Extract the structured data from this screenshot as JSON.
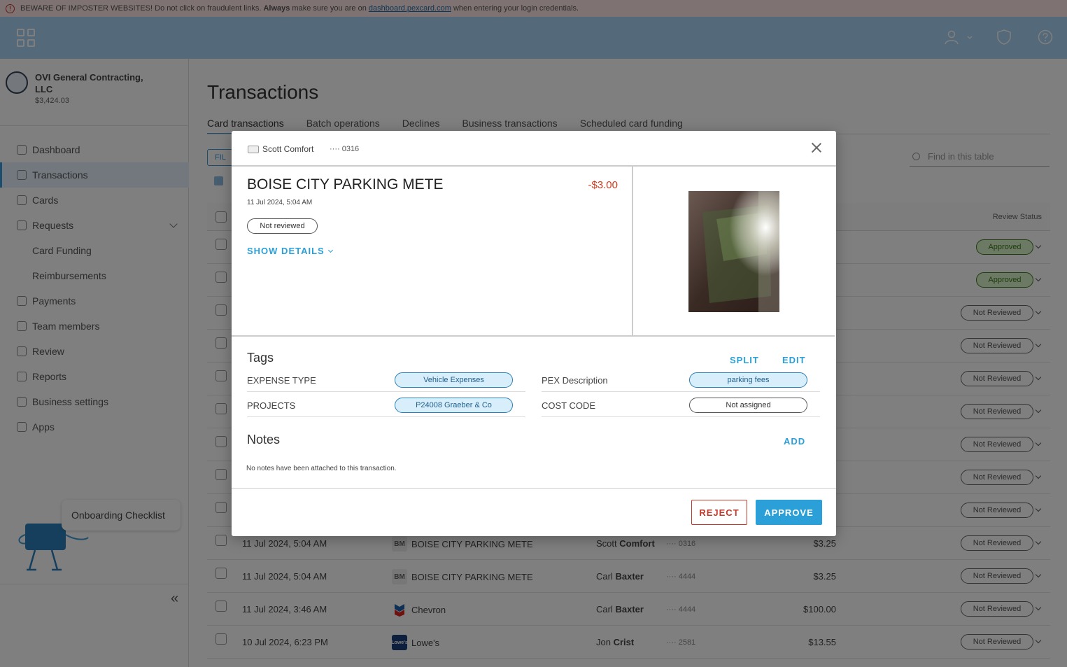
{
  "banner": {
    "lead": "BEWARE OF IMPOSTER WEBSITES!",
    "text1": "Do not click on fraudulent links.",
    "bold": "Always",
    "text2": "make sure you are on",
    "link": "dashboard.pexcard.com",
    "text3": "when entering your login credentials."
  },
  "org": {
    "name": "OVI General Contracting, LLC",
    "balance": "$3,424.03"
  },
  "nav": [
    {
      "label": "Dashboard",
      "icon": "dashboard-icon"
    },
    {
      "label": "Transactions",
      "icon": "transactions-icon"
    },
    {
      "label": "Cards",
      "icon": "cards-icon"
    },
    {
      "label": "Requests",
      "icon": "requests-icon"
    },
    {
      "label": "Card Funding",
      "icon": ""
    },
    {
      "label": "Reimbursements",
      "icon": ""
    },
    {
      "label": "Payments",
      "icon": "payments-icon"
    },
    {
      "label": "Team members",
      "icon": "team-icon"
    },
    {
      "label": "Review",
      "icon": "review-icon"
    },
    {
      "label": "Reports",
      "icon": "reports-icon"
    },
    {
      "label": "Business settings",
      "icon": "settings-icon"
    },
    {
      "label": "Apps",
      "icon": "apps-icon"
    }
  ],
  "onboarding": "Onboarding Checklist",
  "page": {
    "title": "Transactions",
    "tabs": [
      "Card transactions",
      "Batch operations",
      "Declines",
      "Business transactions",
      "Scheduled card funding"
    ],
    "filter_label": "FIL",
    "search_placeholder": "Find in this table",
    "review_status_header": "Review Status"
  },
  "rows": [
    {
      "date": "",
      "merchant": "",
      "logo": "",
      "user_first": "",
      "user_last": "",
      "card": "",
      "amount": "",
      "status": "Approved"
    },
    {
      "date": "",
      "merchant": "",
      "logo": "",
      "user_first": "",
      "user_last": "",
      "card": "",
      "amount": "",
      "status": "Approved"
    },
    {
      "date": "",
      "merchant": "",
      "logo": "",
      "user_first": "",
      "user_last": "",
      "card": "",
      "amount": "",
      "status": "Not Reviewed"
    },
    {
      "date": "",
      "merchant": "",
      "logo": "",
      "user_first": "",
      "user_last": "",
      "card": "",
      "amount": "",
      "status": "Not Reviewed"
    },
    {
      "date": "",
      "merchant": "",
      "logo": "",
      "user_first": "",
      "user_last": "",
      "card": "",
      "amount": "",
      "status": "Not Reviewed"
    },
    {
      "date": "",
      "merchant": "",
      "logo": "",
      "user_first": "",
      "user_last": "",
      "card": "",
      "amount": "",
      "status": "Not Reviewed"
    },
    {
      "date": "",
      "merchant": "",
      "logo": "",
      "user_first": "",
      "user_last": "",
      "card": "",
      "amount": "",
      "status": "Not Reviewed"
    },
    {
      "date": "",
      "merchant": "",
      "logo": "",
      "user_first": "",
      "user_last": "",
      "card": "",
      "amount": "",
      "status": "Not Reviewed"
    },
    {
      "date": "",
      "merchant": "",
      "logo": "",
      "user_first": "",
      "user_last": "",
      "card": "",
      "amount": "",
      "status": "Not Reviewed"
    },
    {
      "date": "11 Jul 2024, 5:04 AM",
      "merchant": "BOISE CITY PARKING METE",
      "logo": "BM",
      "user_first": "Scott",
      "user_last": "Comfort",
      "card": "···· 0316",
      "amount": "$3.25",
      "status": "Not Reviewed"
    },
    {
      "date": "11 Jul 2024, 5:04 AM",
      "merchant": "BOISE CITY PARKING METE",
      "logo": "BM",
      "user_first": "Carl",
      "user_last": "Baxter",
      "card": "···· 4444",
      "amount": "$3.25",
      "status": "Not Reviewed"
    },
    {
      "date": "11 Jul 2024, 3:46 AM",
      "merchant": "Chevron",
      "logo": "",
      "user_first": "Carl",
      "user_last": "Baxter",
      "card": "···· 4444",
      "amount": "$100.00",
      "status": "Not Reviewed"
    },
    {
      "date": "10 Jul 2024, 6:23 PM",
      "merchant": "Lowe's",
      "logo": "",
      "user_first": "Jon",
      "user_last": "Crist",
      "card": "···· 2581",
      "amount": "$13.55",
      "status": "Not Reviewed"
    }
  ],
  "modal": {
    "cardholder": "Scott Comfort",
    "card_last4": "···· 0316",
    "merchant": "BOISE CITY PARKING METE",
    "amount": "-$3.00",
    "date": "11 Jul 2024, 5:04 AM",
    "review_status": "Not reviewed",
    "show_details": "SHOW DETAILS",
    "tags_title": "Tags",
    "split": "SPLIT",
    "edit": "EDIT",
    "tags": [
      {
        "label": "EXPENSE TYPE",
        "value": "Vehicle Expenses",
        "assigned": true
      },
      {
        "label": "PEX Description",
        "value": "parking fees",
        "assigned": true
      },
      {
        "label": "PROJECTS",
        "value": "P24008 Graeber & Co",
        "assigned": true
      },
      {
        "label": "COST CODE",
        "value": "Not assigned",
        "assigned": false
      }
    ],
    "notes_title": "Notes",
    "add": "ADD",
    "notes_empty": "No notes have been attached to this transaction.",
    "reject": "REJECT",
    "approve": "APPROVE"
  },
  "colors": {
    "accent": "#2ba0d8",
    "header": "#a9d3f3",
    "negative": "#d0391b",
    "approved_bg": "#d9f2c8"
  }
}
